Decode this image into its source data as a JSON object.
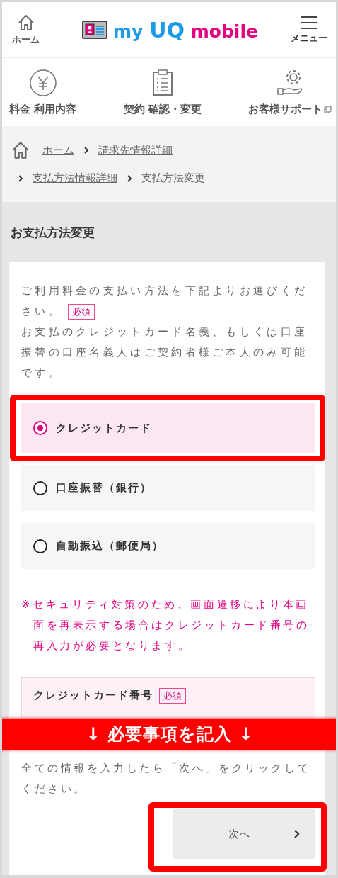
{
  "header": {
    "home_label": "ホーム",
    "logo": [
      "my",
      "UQ",
      "mobile"
    ],
    "menu_label": "メニュー"
  },
  "nav": [
    {
      "label": "料金 利用内容",
      "external": false
    },
    {
      "label": "契約 確認・変更",
      "external": false
    },
    {
      "label": "お客様サポート",
      "external": true
    }
  ],
  "breadcrumb": [
    {
      "label": "ホーム",
      "link": true
    },
    {
      "label": "請求先情報詳細",
      "link": true
    },
    {
      "label": "支払方法情報詳細",
      "link": true
    },
    {
      "label": "支払方法変更",
      "link": false
    }
  ],
  "page_title": "お支払方法変更",
  "intro_lines": [
    "ご利用料金の支払い方法を下記よりお選びくだ",
    "さい。"
  ],
  "required_badge": "必須",
  "intro_note": "お支払のクレジットカード名義、もしくは口座振替の口座名義人はご契約者様ご本人のみ可能です。",
  "payment_options": [
    {
      "label": "クレジットカード",
      "selected": true,
      "highlighted": true
    },
    {
      "label": "口座振替（銀行）",
      "selected": false,
      "highlighted": false
    },
    {
      "label": "自動振込（郵便局）",
      "selected": false,
      "highlighted": false
    }
  ],
  "security_note": "※セキュリティ対策のため、画面遷移により本画面を再表示する場合はクレジットカード番号の再入力が必要となります。",
  "card_field": {
    "label": "クレジットカード番号",
    "badge": "必須"
  },
  "banner": "↓ 必要事項を記入 ↓",
  "instruction": "全ての情報を入力したら「次へ」をクリックしてください。",
  "next_button": {
    "label": "次へ",
    "highlighted": true
  }
}
